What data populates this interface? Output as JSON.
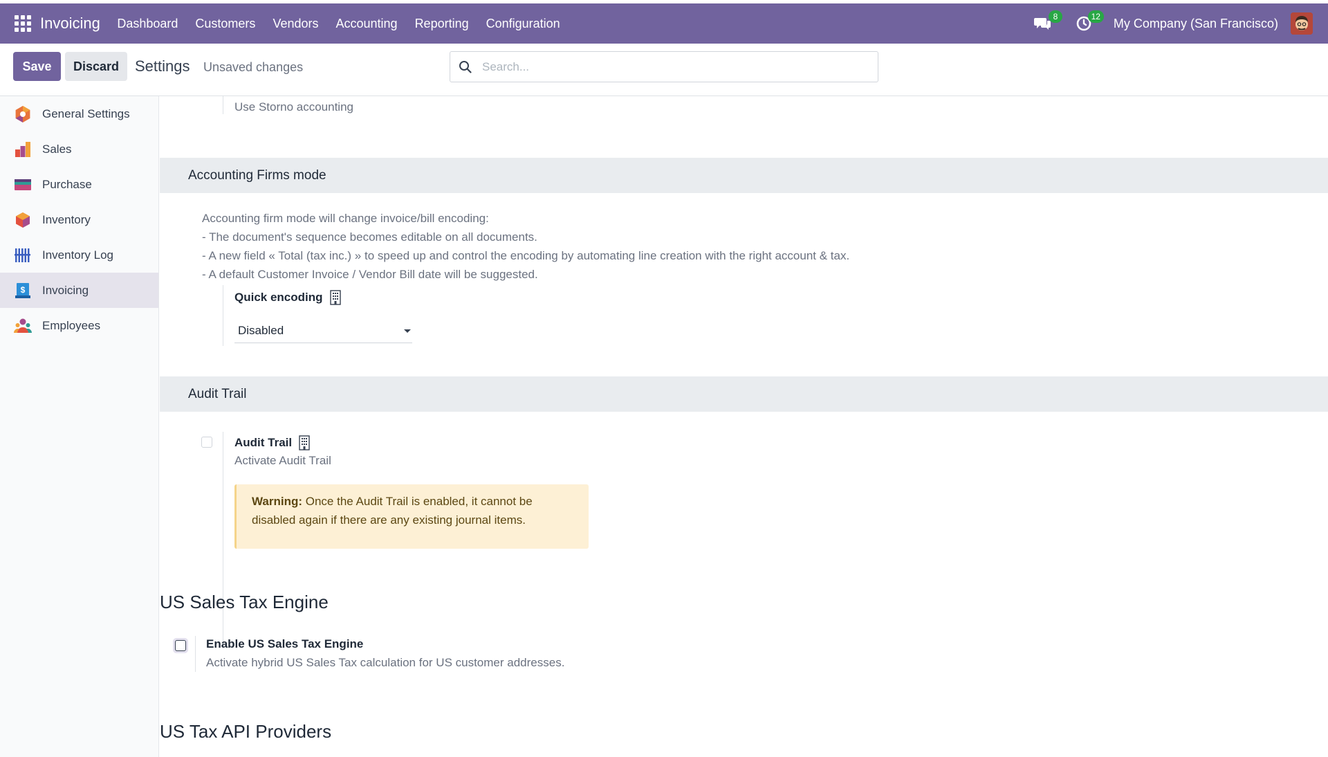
{
  "navbar": {
    "app_name": "Invoicing",
    "menu": [
      "Dashboard",
      "Customers",
      "Vendors",
      "Accounting",
      "Reporting",
      "Configuration"
    ],
    "messages_count": "8",
    "activities_count": "12",
    "company": "My Company (San Francisco)",
    "color": "#71639e"
  },
  "control": {
    "save_label": "Save",
    "discard_label": "Discard",
    "title": "Settings",
    "status": "Unsaved changes",
    "search_placeholder": "Search..."
  },
  "sidebar": {
    "items": [
      {
        "label": "General Settings",
        "icon": "general-settings-icon"
      },
      {
        "label": "Sales",
        "icon": "sales-icon"
      },
      {
        "label": "Purchase",
        "icon": "purchase-icon"
      },
      {
        "label": "Inventory",
        "icon": "inventory-icon"
      },
      {
        "label": "Inventory Log",
        "icon": "inventory-log-icon"
      },
      {
        "label": "Invoicing",
        "icon": "invoicing-icon",
        "active": true
      },
      {
        "label": "Employees",
        "icon": "employees-icon"
      }
    ]
  },
  "main": {
    "storno": "Use Storno accounting",
    "firms": {
      "title": "Accounting Firms mode",
      "desc": [
        "Accounting firm mode will change invoice/bill encoding:",
        "- The document's sequence becomes editable on all documents.",
        "- A new field « Total (tax inc.) » to speed up and control the encoding by automating line creation with the right account & tax.",
        "- A default Customer Invoice / Vendor Bill date will be suggested."
      ],
      "quick_encoding_label": "Quick encoding",
      "quick_encoding_value": "Disabled"
    },
    "audit": {
      "title": "Audit Trail",
      "setting_label": "Audit Trail",
      "setting_desc": "Activate Audit Trail",
      "warning_strong": "Warning:",
      "warning_text": " Once the Audit Trail is enabled, it cannot be disabled again if there are any existing journal items."
    },
    "us_tax": {
      "title": "US Sales Tax Engine",
      "setting_label": "Enable US Sales Tax Engine",
      "setting_desc": "Activate hybrid US Sales Tax calculation for US customer addresses."
    },
    "us_api": {
      "title": "US Tax API Providers"
    }
  }
}
